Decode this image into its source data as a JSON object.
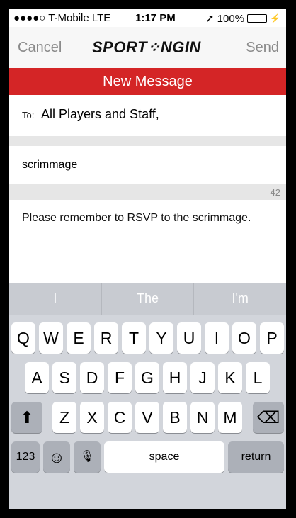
{
  "status": {
    "carrier": "●●●●○ T-Mobile  LTE",
    "time": "1:17 PM",
    "battery_text": "100%",
    "battery_level": 1.0,
    "location_icon": "location-arrow-icon"
  },
  "nav": {
    "cancel": "Cancel",
    "send": "Send",
    "logo": "SPORT⁘NGIN"
  },
  "title": "New Message",
  "compose": {
    "to_label": "To:",
    "to_value": "All Players and Staff,",
    "subject": "scrimmage",
    "char_count": "42",
    "body": "Please remember to RSVP to the scrimmage."
  },
  "keyboard": {
    "suggestions": [
      "I",
      "The",
      "I'm"
    ],
    "row1": [
      "Q",
      "W",
      "E",
      "R",
      "T",
      "Y",
      "U",
      "I",
      "O",
      "P"
    ],
    "row2": [
      "A",
      "S",
      "D",
      "F",
      "G",
      "H",
      "J",
      "K",
      "L"
    ],
    "row3": [
      "Z",
      "X",
      "C",
      "V",
      "B",
      "N",
      "M"
    ],
    "shift": "⬆",
    "backspace": "⌫",
    "numbers": "123",
    "emoji": "☺",
    "mic": "🎙",
    "space": "space",
    "return": "return"
  },
  "colors": {
    "brand_red": "#d42526",
    "battery_green": "#4cd964",
    "nav_gray": "#8a8a8a"
  }
}
